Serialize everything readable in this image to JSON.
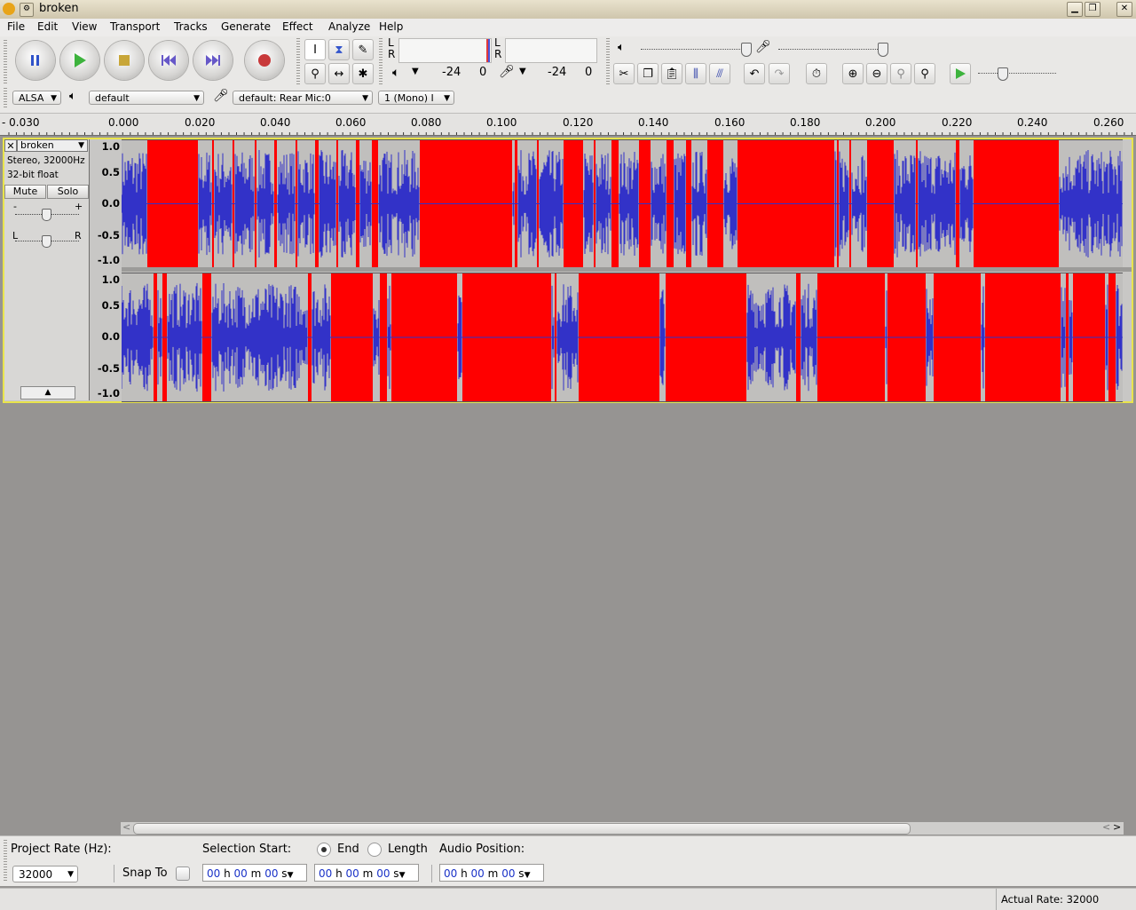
{
  "window": {
    "title": "broken"
  },
  "menu": [
    "File",
    "Edit",
    "View",
    "Transport",
    "Tracks",
    "Generate",
    "Effect",
    "Analyze",
    "Help"
  ],
  "meters": {
    "left_channel": "L",
    "right_channel": "R",
    "play_db": "-24",
    "play_zero": "0",
    "rec_db": "-24",
    "rec_zero": "0"
  },
  "device": {
    "host": "ALSA",
    "output": "default",
    "input": "default: Rear Mic:0",
    "channels": "1 (Mono) I"
  },
  "ruler": {
    "ticks": [
      "- 0.030",
      "0.000",
      "0.020",
      "0.040",
      "0.060",
      "0.080",
      "0.100",
      "0.120",
      "0.140",
      "0.160",
      "0.180",
      "0.200",
      "0.220",
      "0.240",
      "0.260"
    ]
  },
  "track": {
    "name": "broken",
    "format": "Stereo, 32000Hz",
    "bitdepth": "32-bit float",
    "mute": "Mute",
    "solo": "Solo",
    "gain_minus": "-",
    "gain_plus": "+",
    "pan_left": "L",
    "pan_right": "R",
    "scale": [
      "1.0",
      "0.5",
      "0.0",
      "-0.5",
      "-1.0"
    ],
    "clip_color": "#ff0000",
    "wave_color": "#3232c8"
  },
  "selection": {
    "project_rate_label": "Project Rate (Hz):",
    "project_rate": "32000",
    "snap_label": "Snap To",
    "selection_start_label": "Selection Start:",
    "end_label": "End",
    "length_label": "Length",
    "audio_position_label": "Audio Position:",
    "time_hh": "00",
    "time_h": "h",
    "time_mm": "00",
    "time_m": "m",
    "time_ss": "00",
    "time_s": "s"
  },
  "status": {
    "actual_rate": "Actual Rate: 32000"
  }
}
